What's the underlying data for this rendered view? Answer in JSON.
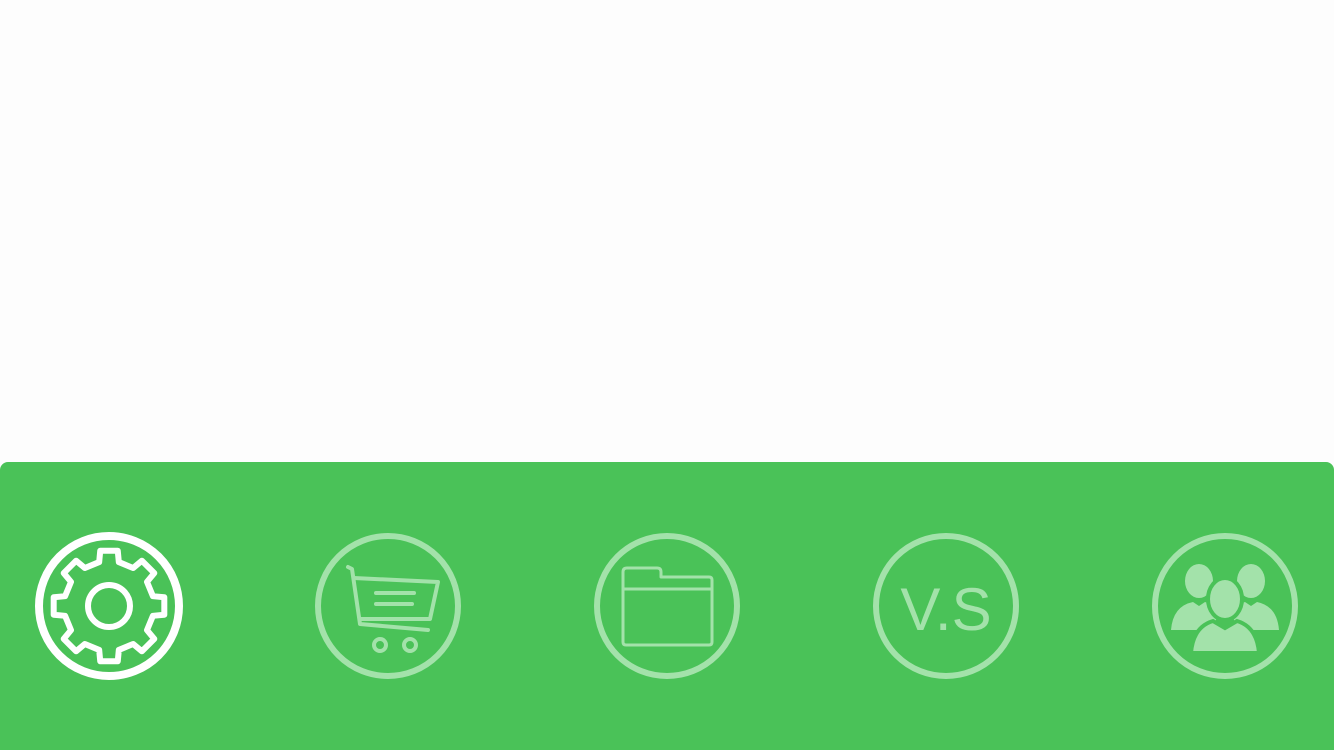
{
  "screen": {
    "background": "#fdfdfd",
    "bar_color": "#4ac258",
    "active_color": "#ffffff",
    "inactive_color": "#a3e2aa"
  },
  "tab_bar": {
    "active_index": 0,
    "items": [
      {
        "id": "settings",
        "icon": "gear-icon",
        "active": true
      },
      {
        "id": "cart",
        "icon": "shopping-cart-icon",
        "active": false
      },
      {
        "id": "folder",
        "icon": "folder-icon",
        "active": false
      },
      {
        "id": "versus",
        "icon": "versus-icon",
        "label": "V.S",
        "active": false
      },
      {
        "id": "users",
        "icon": "users-group-icon",
        "active": false
      }
    ]
  }
}
